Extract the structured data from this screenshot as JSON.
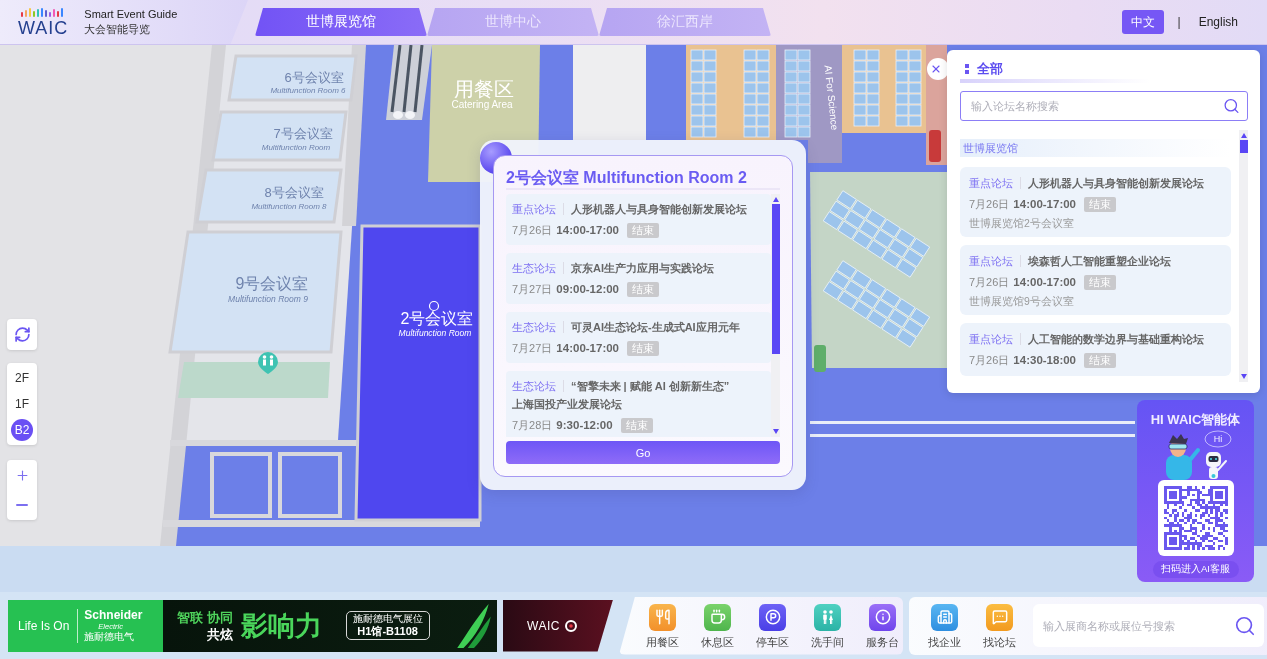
{
  "header": {
    "logo_text": "WAIC",
    "title": "Smart Event Guide",
    "subtitle": "大会智能导览",
    "venue_tabs": [
      {
        "label": "世博展览馆",
        "selected": true
      },
      {
        "label": "世博中心",
        "selected": false
      },
      {
        "label": "徐汇西岸",
        "selected": false
      }
    ],
    "languages": [
      {
        "label": "中文",
        "selected": true
      },
      {
        "label": "English",
        "selected": false
      }
    ],
    "language_separator": "|"
  },
  "map": {
    "rooms": [
      {
        "name": "6号会议室",
        "subtitle": "Multifunction Room 6",
        "selected": false
      },
      {
        "name": "7号会议室",
        "subtitle": "Multifunction Room",
        "selected": false
      },
      {
        "name": "8号会议室",
        "subtitle": "Multifunction Room 8",
        "selected": false
      },
      {
        "name": "9号会议室",
        "subtitle": "Multifunction Room 9",
        "selected": false
      },
      {
        "name": "2号会议室",
        "subtitle": "Multifunction Room",
        "selected": true
      }
    ],
    "areas": [
      {
        "name": "用餐区",
        "subtitle": "Catering Area"
      }
    ],
    "zone_labels": [
      "AI For Science"
    ]
  },
  "floor_switcher": [
    {
      "label": "2F",
      "selected": false
    },
    {
      "label": "1F",
      "selected": false
    },
    {
      "label": "B2",
      "selected": true
    }
  ],
  "room_popup": {
    "title": "2号会议室 Multifunction Room 2",
    "events": [
      {
        "category": "重点论坛",
        "title": "人形机器人与具身智能创新发展论坛",
        "date": "7月26日",
        "time": "14:00-17:00",
        "status": "结束"
      },
      {
        "category": "生态论坛",
        "title": "京东AI生产力应用与实践论坛",
        "date": "7月27日",
        "time": "09:00-12:00",
        "status": "结束"
      },
      {
        "category": "生态论坛",
        "title": "可灵AI生态论坛-生成式AI应用元年",
        "date": "7月27日",
        "time": "14:00-17:00",
        "status": "结束"
      },
      {
        "category": "生态论坛",
        "title": "“智擎未来 | 赋能 AI 创新新生态” 上海国投产业发展论坛",
        "date": "7月28日",
        "time": "9:30-12:00",
        "status": "结束"
      }
    ],
    "button": "Go"
  },
  "forum_panel": {
    "heading": "全部",
    "search": {
      "placeholder": "输入论坛名称搜索"
    },
    "sections": [
      {
        "venue": "世博展览馆",
        "events": [
          {
            "category": "重点论坛",
            "title": "人形机器人与具身智能创新发展论坛",
            "date": "7月26日",
            "time": "14:00-17:00",
            "status": "结束",
            "location": "世博展览馆2号会议室"
          },
          {
            "category": "重点论坛",
            "title": "埃森哲人工智能重塑企业论坛",
            "date": "7月26日",
            "time": "14:00-17:00",
            "status": "结束",
            "location": "世博展览馆9号会议室"
          },
          {
            "category": "重点论坛",
            "title": "人工智能的数学边界与基础重构论坛",
            "date": "7月26日",
            "time": "14:30-18:00",
            "status": "结束"
          }
        ]
      }
    ]
  },
  "ai_assistant": {
    "title": "HI WAIC智能体",
    "bubble": "Hi",
    "button": "扫码进入AI客服"
  },
  "ad_banners": [
    {
      "kind": "schneider",
      "slogan": "Life Is On",
      "brand": "Schneider",
      "brand_sub": "Electric",
      "brand_cn": "施耐德电气",
      "taglines": [
        "智联 协同",
        "共炫"
      ],
      "headline": "影响力",
      "booth_caption": "施耐德电气展位",
      "booth_number": "H1馆-B1108"
    },
    {
      "kind": "waic",
      "logo_text": "WAIC"
    }
  ],
  "facilities": [
    {
      "kind": "dining",
      "label": "用餐区"
    },
    {
      "kind": "rest",
      "label": "休息区"
    },
    {
      "kind": "parking",
      "label": "停车区"
    },
    {
      "kind": "restroom",
      "label": "洗手间"
    },
    {
      "kind": "service",
      "label": "服务台"
    }
  ],
  "quick_links": [
    {
      "kind": "company",
      "label": "找企业"
    },
    {
      "kind": "forum",
      "label": "找论坛"
    }
  ],
  "exhibitor_search": {
    "placeholder": "输入展商名称或展位号搜索"
  }
}
